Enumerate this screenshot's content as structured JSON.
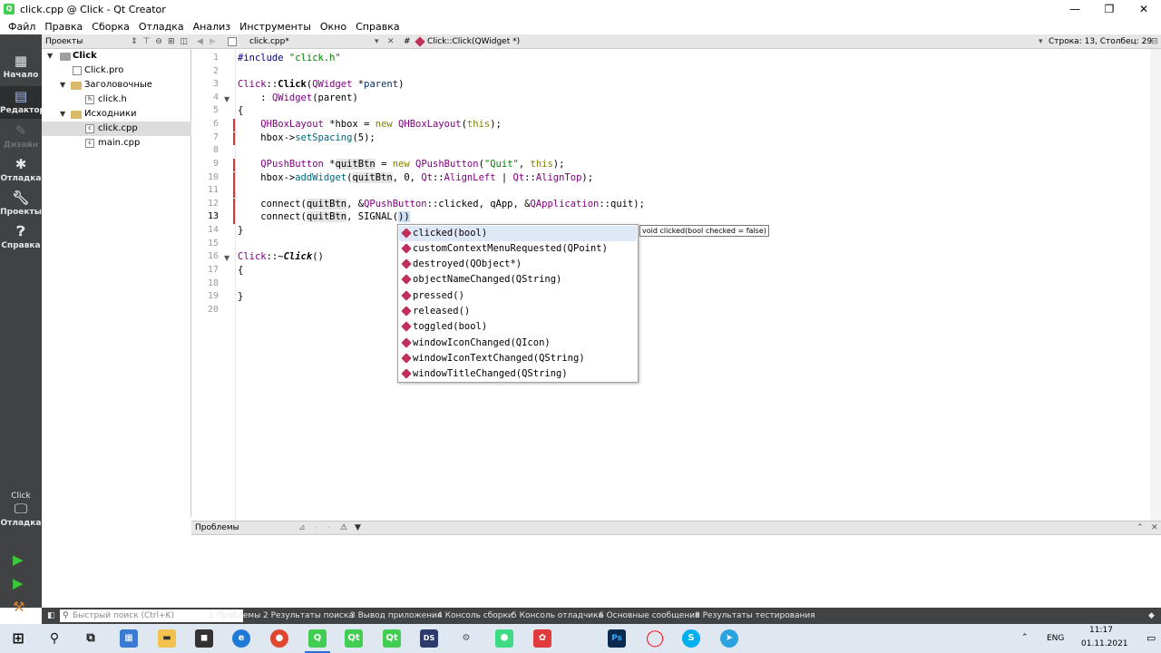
{
  "window": {
    "title": "click.cpp @ Click - Qt Creator",
    "minimize": "—",
    "maximize": "❐",
    "close": "✕"
  },
  "menu": [
    "Файл",
    "Правка",
    "Сборка",
    "Отладка",
    "Анализ",
    "Инструменты",
    "Окно",
    "Справка"
  ],
  "modes": [
    {
      "label": "Начало",
      "icon": "grid-icon"
    },
    {
      "label": "Редактор",
      "icon": "editor-icon"
    },
    {
      "label": "Дизайн",
      "icon": "pencil-icon"
    },
    {
      "label": "Отладка",
      "icon": "bug-icon"
    },
    {
      "label": "Проекты",
      "icon": "wrench-icon"
    },
    {
      "label": "Справка",
      "icon": "help-icon"
    }
  ],
  "kit": {
    "name": "Click",
    "label": "Отладка"
  },
  "project_panel": {
    "title": "Проекты",
    "tree": [
      {
        "label": "Click",
        "bold": true
      },
      {
        "label": "Click.pro"
      },
      {
        "label": "Заголовочные"
      },
      {
        "label": "click.h"
      },
      {
        "label": "Исходники"
      },
      {
        "label": "click.cpp"
      },
      {
        "label": "main.cpp"
      }
    ]
  },
  "editor_header": {
    "file": "click.cpp*",
    "hash": "#",
    "symbol": "Click::Click(QWidget *)",
    "position": "Строка: 13, Столбец: 29"
  },
  "code": {
    "line_numbers": [
      "1",
      "2",
      "3",
      "4",
      "5",
      "6",
      "7",
      "8",
      "9",
      "10",
      "11",
      "12",
      "13",
      "14",
      "15",
      "16",
      "17",
      "18",
      "19",
      "20"
    ],
    "l1": {
      "a": "#include ",
      "b": "\"click.h\""
    },
    "l3": {
      "a": "Click",
      "b": "::",
      "c": "Click",
      "d": "(",
      "e": "QWidget",
      "f": " *",
      "g": "parent",
      "h": ")"
    },
    "l4": {
      "a": "    : ",
      "b": "QWidget",
      "c": "(parent)"
    },
    "l5": "{",
    "l6": {
      "a": "    ",
      "b": "QHBoxLayout",
      "c": " *hbox = ",
      "d": "new",
      "e": " ",
      "f": "QHBoxLayout",
      "g": "(",
      "h": "this",
      "i": ");"
    },
    "l7": {
      "a": "    hbox->",
      "b": "setSpacing",
      "c": "(5);"
    },
    "l9": {
      "a": "    ",
      "b": "QPushButton",
      "c": " *",
      "d": "quitBtn",
      "e": " = ",
      "f": "new",
      "g": " ",
      "h": "QPushButton",
      "i": "(",
      "j": "\"Quit\"",
      "k": ", ",
      "l": "this",
      "m": ");"
    },
    "l10": {
      "a": "    hbox->",
      "b": "addWidget",
      "c": "(",
      "d": "quitBtn",
      "e": ", 0, ",
      "f": "Qt",
      "g": "::",
      "h": "AlignLeft",
      "i": " | ",
      "j": "Qt",
      "k": "::",
      "l": "AlignTop",
      "m": ");"
    },
    "l12": {
      "a": "    connect(",
      "b": "quitBtn",
      "c": ", &",
      "d": "QPushButton",
      "e": "::",
      "f": "clicked",
      "g": ", ",
      "h": "qApp",
      "i": ", &",
      "j": "QApplication",
      "k": "::",
      "l": "quit",
      "m": ");"
    },
    "l13": {
      "a": "    connect(",
      "b": "quitBtn",
      "c": ", ",
      "d": "SIGNAL",
      "e": "(",
      "f": "))"
    },
    "l14": "}",
    "l16": {
      "a": "Click",
      "b": "::~",
      "c": "Click",
      "d": "()"
    },
    "l17": "{",
    "l19": "}"
  },
  "completion": {
    "items": [
      "clicked(bool)",
      "customContextMenuRequested(QPoint)",
      "destroyed(QObject*)",
      "objectNameChanged(QString)",
      "pressed()",
      "released()",
      "toggled(bool)",
      "windowIconChanged(QIcon)",
      "windowIconTextChanged(QString)",
      "windowTitleChanged(QString)"
    ],
    "tooltip": "void clicked(bool checked = false)"
  },
  "problems": {
    "title": "Проблемы"
  },
  "statusbar": {
    "search_placeholder": "Быстрый поиск (Ctrl+K)",
    "tabs": [
      "1 Проблемы",
      "2 Результаты поиска",
      "3 Вывод приложения",
      "4 Консоль сборки",
      "5 Консоль отладчика",
      "6 Основные сообщения",
      "8 Результаты тестирования"
    ]
  },
  "tray": {
    "lang": "ENG",
    "time": "11:17",
    "date": "01.11.2021"
  },
  "taskbar_apps": [
    "windows-start",
    "search",
    "task-view",
    "calculator",
    "file-explorer",
    "store",
    "edge",
    "chrome",
    "qt-creator",
    "qt",
    "qt",
    "designer",
    "tool",
    "android",
    "app",
    "photoshop",
    "opera",
    "skype",
    "telegram"
  ],
  "colors": {
    "accent": "#2c2e30",
    "selection": "#dfe8f6",
    "error_marker": "#e03030"
  }
}
